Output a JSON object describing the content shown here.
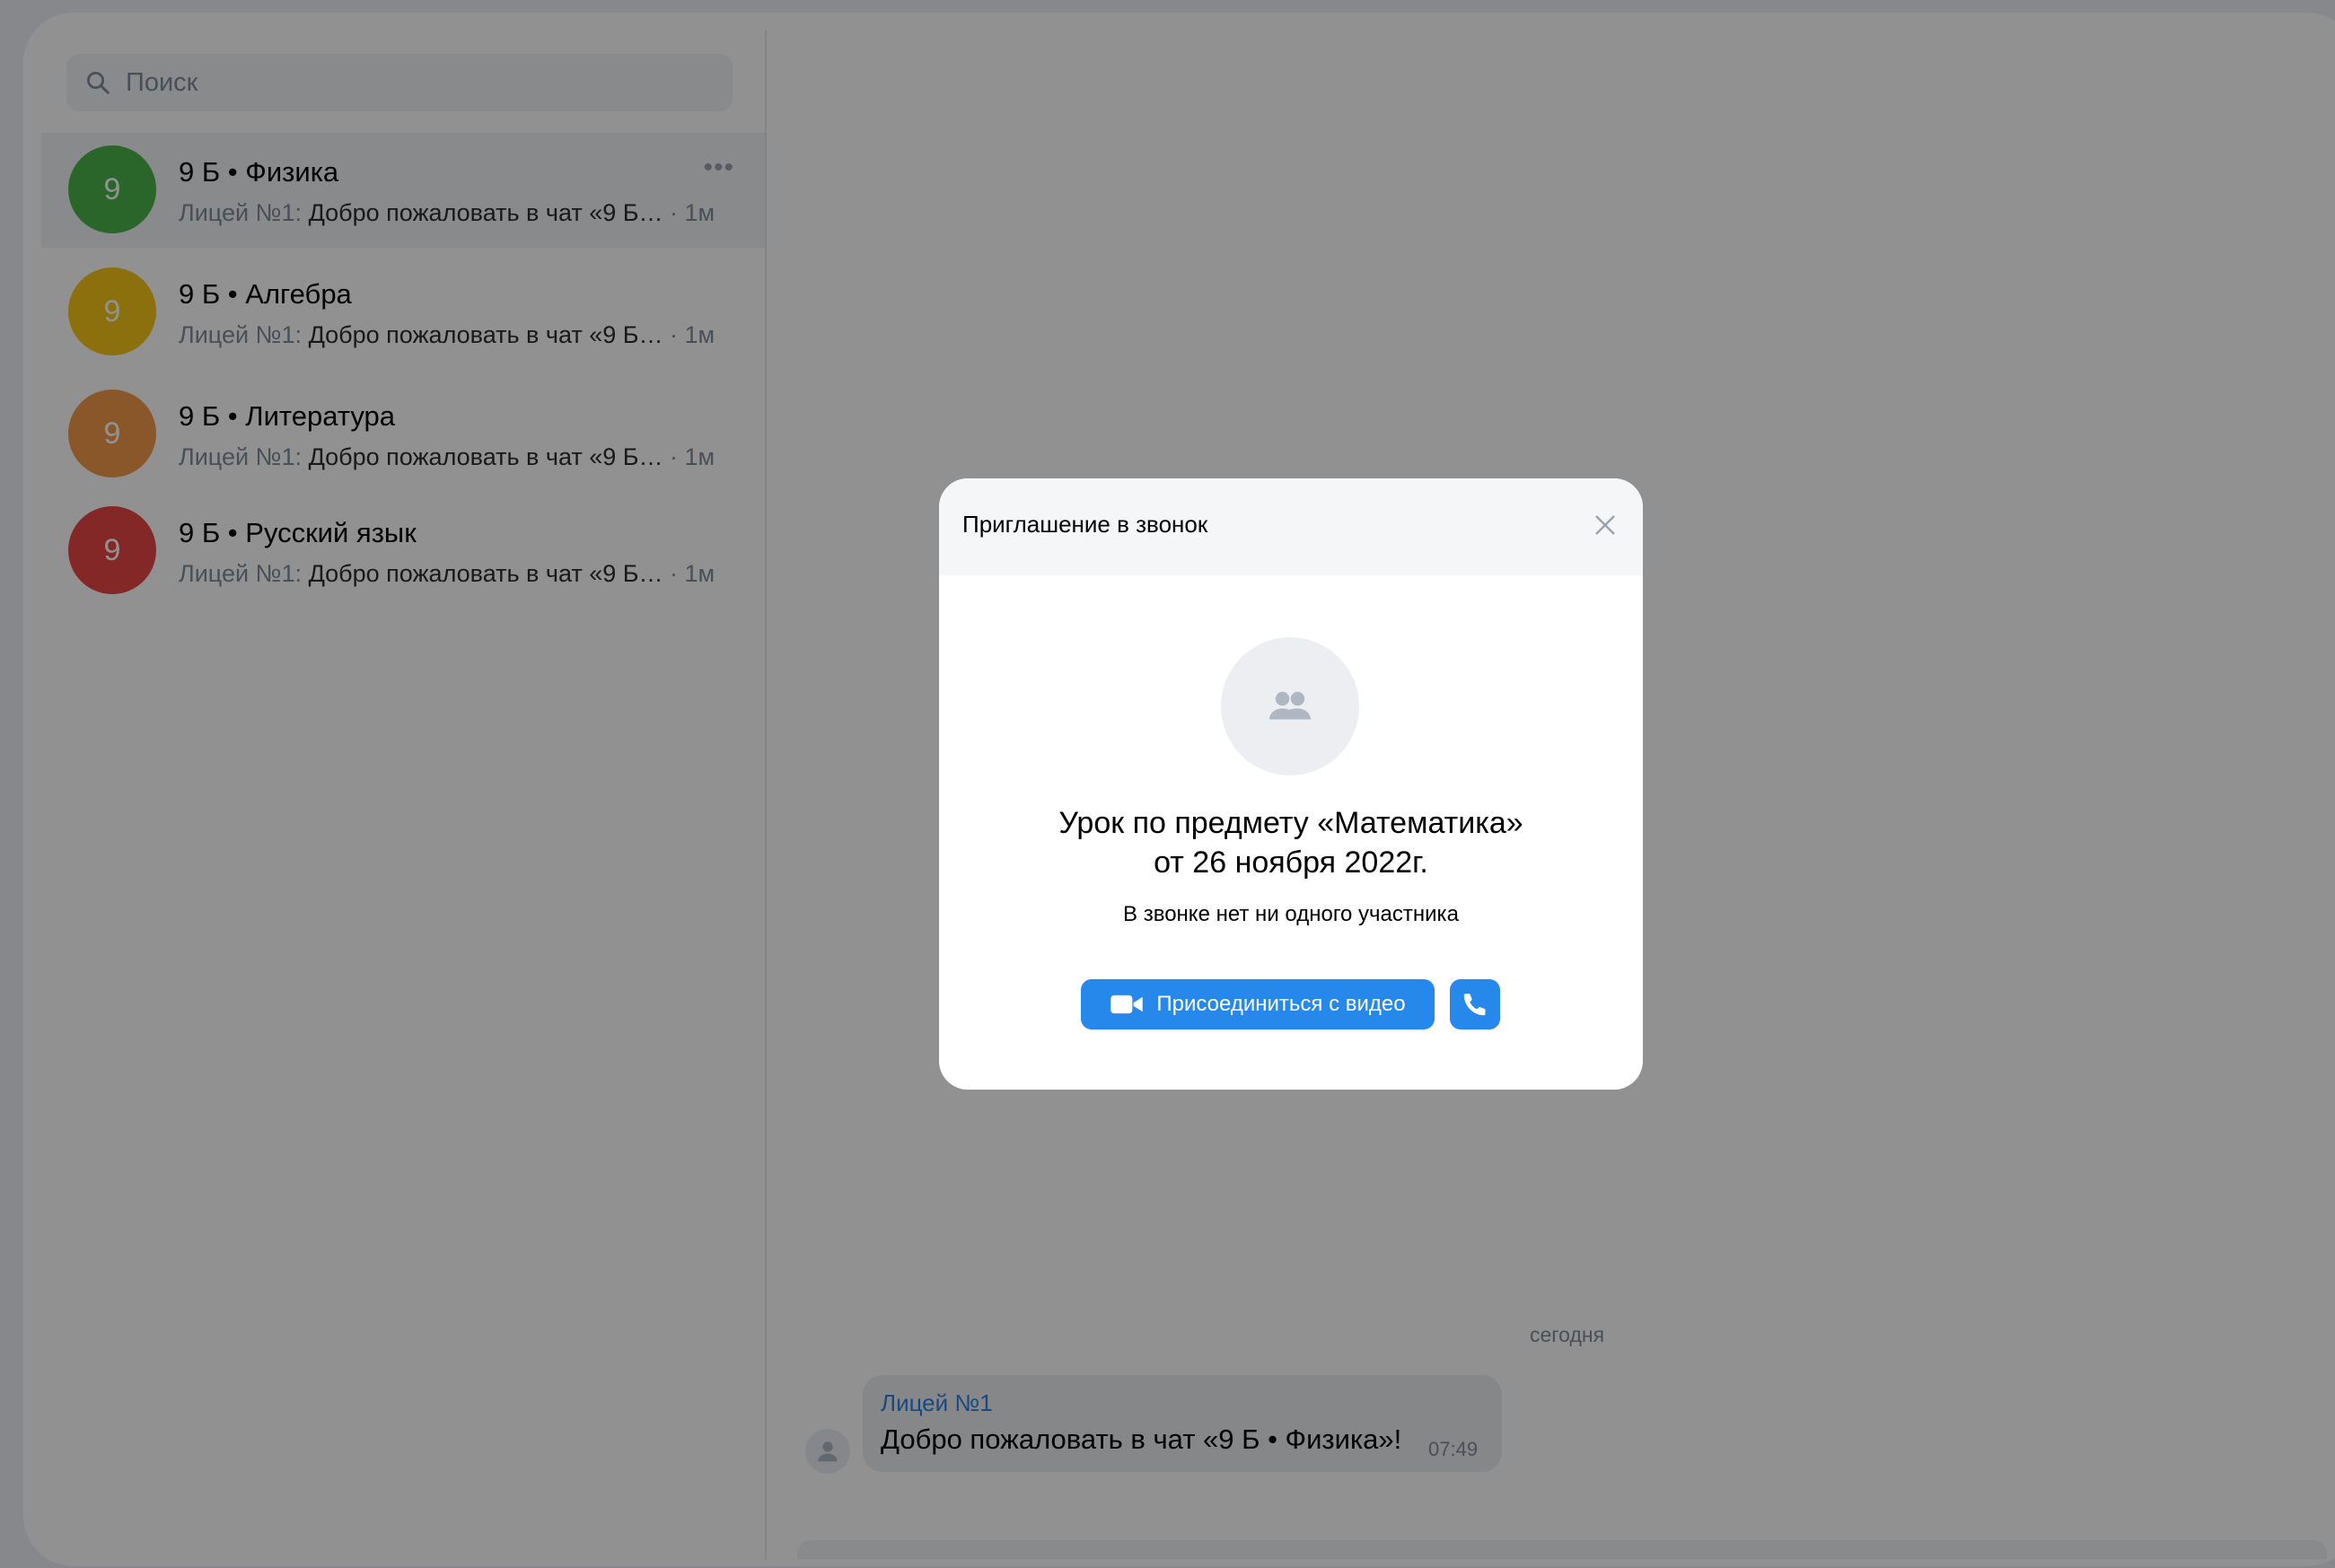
{
  "search": {
    "placeholder": "Поиск"
  },
  "chats": [
    {
      "avatar_text": "9",
      "avatar_color": "#4bb34b",
      "title": "9 Б • Физика",
      "sender": "Лицей №1:",
      "preview": "Добро пожаловать в чат «9 Б…",
      "time": "· 1м",
      "more": "•••"
    },
    {
      "avatar_text": "9",
      "avatar_color": "#f5c518",
      "title": "9 Б • Алгебра",
      "sender": "Лицей №1:",
      "preview": "Добро пожаловать в чат «9 Б…",
      "time": "· 1м"
    },
    {
      "avatar_text": "9",
      "avatar_color": "#f2994a",
      "title": "9 Б • Литература",
      "sender": "Лицей №1:",
      "preview": "Добро пожаловать в чат «9 Б…",
      "time": "· 1м"
    },
    {
      "avatar_text": "9",
      "avatar_color": "#e64646",
      "title": "9 Б • Русский язык",
      "sender": "Лицей №1:",
      "preview": "Добро пожаловать в чат «9 Б…",
      "time": "· 1м"
    }
  ],
  "conversation": {
    "date_separator": "сегодня",
    "message": {
      "author": "Лицей №1",
      "text": "Добро пожаловать в чат «9 Б • Физика»!",
      "time": "07:49"
    }
  },
  "modal": {
    "title": "Приглашение в звонок",
    "call_title_line1": "Урок по предмету «Математика»",
    "call_title_line2": "от 26 ноября 2022г.",
    "participants_text": "В звонке нет ни одного участника",
    "join_video_label": "Присоединиться с видео"
  },
  "colors": {
    "accent": "#2688eb",
    "overlay": "rgba(0,0,0,0.43)"
  },
  "icons": [
    "search-icon",
    "more-icon",
    "user-icon",
    "group-icon",
    "close-icon",
    "video-camera-icon",
    "phone-icon"
  ]
}
